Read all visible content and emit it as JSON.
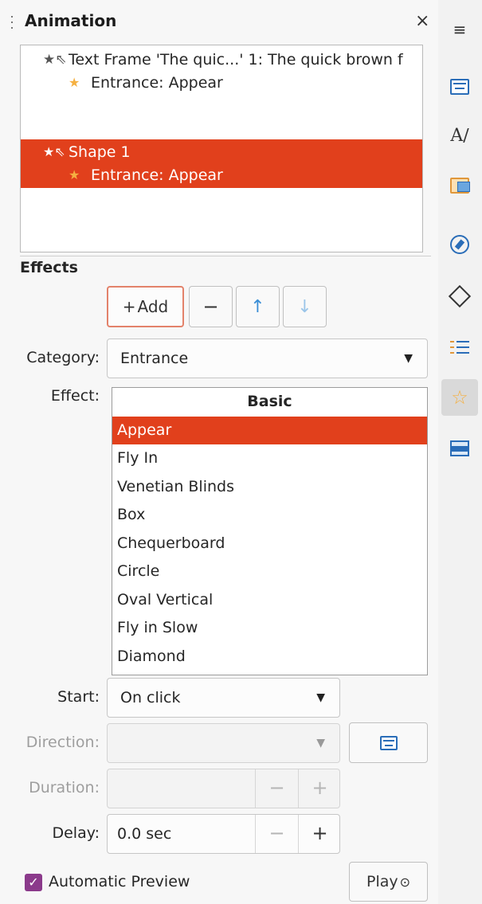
{
  "panel": {
    "title": "Animation",
    "close_glyph": "×"
  },
  "animation_list": {
    "items": [
      {
        "label": "Text Frame 'The quic...' 1: The quick brown f",
        "icon": "pointer-star-icon",
        "level": 0,
        "selected": false
      },
      {
        "label": "Entrance: Appear",
        "icon": "star-icon",
        "level": 1,
        "selected": false
      },
      {
        "label": "Shape 1",
        "icon": "pointer-star-icon",
        "level": 0,
        "selected": true
      },
      {
        "label": "Entrance: Appear",
        "icon": "star-icon",
        "level": 1,
        "selected": true
      }
    ]
  },
  "effects": {
    "heading": "Effects",
    "add_label": "Add",
    "add_glyph": "+",
    "remove_glyph": "−",
    "up_glyph": "↑",
    "down_glyph": "↓",
    "category_label": "Category:",
    "category_value": "Entrance",
    "effect_label": "Effect:",
    "effect_group": "Basic",
    "effect_items": [
      "Appear",
      "Fly In",
      "Venetian Blinds",
      "Box",
      "Chequerboard",
      "Circle",
      "Oval Vertical",
      "Fly in Slow",
      "Diamond"
    ],
    "selected_effect": "Appear"
  },
  "settings": {
    "start_label": "Start:",
    "start_value": "On click",
    "direction_label": "Direction:",
    "direction_value": "",
    "duration_label": "Duration:",
    "duration_value": "",
    "delay_label": "Delay:",
    "delay_value": "0.0 sec",
    "minus_glyph": "−",
    "plus_glyph": "+"
  },
  "preview": {
    "automatic_label": "Automatic Preview",
    "automatic_checked": true,
    "play_label": "Play"
  },
  "sidebar": {
    "items": [
      {
        "name": "menu",
        "icon": "hamburger-menu-icon"
      },
      {
        "name": "properties",
        "icon": "properties-icon"
      },
      {
        "name": "styles",
        "icon": "styles-icon"
      },
      {
        "name": "gallery",
        "icon": "gallery-icon"
      },
      {
        "name": "navigator",
        "icon": "navigator-icon"
      },
      {
        "name": "shapes",
        "icon": "shapes-icon"
      },
      {
        "name": "master-slides",
        "icon": "master-slides-icon"
      },
      {
        "name": "animation",
        "icon": "animation-icon",
        "active": true
      },
      {
        "name": "slide-transition",
        "icon": "slide-transition-icon"
      }
    ]
  },
  "colors": {
    "accent": "#e1401c",
    "checkbox": "#8b3a8b",
    "icon_blue": "#2a6db8",
    "star": "#f5b041"
  }
}
